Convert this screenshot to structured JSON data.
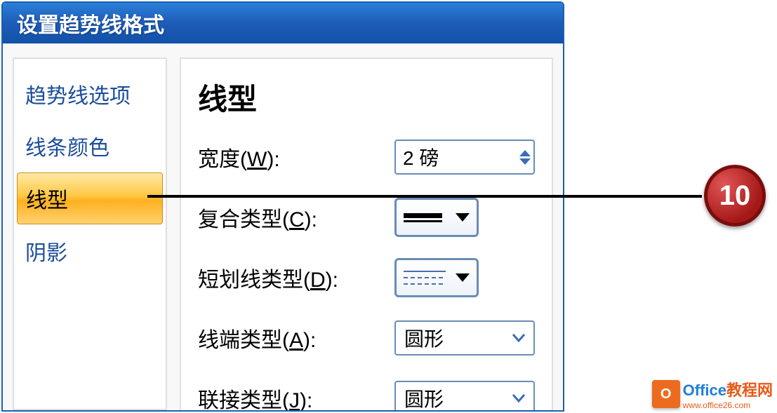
{
  "dialog": {
    "title": "设置趋势线格式"
  },
  "sidebar": {
    "items": [
      {
        "label": "趋势线选项"
      },
      {
        "label": "线条颜色"
      },
      {
        "label": "线型"
      },
      {
        "label": "阴影"
      }
    ]
  },
  "content": {
    "section_title": "线型",
    "width_label_pre": "宽度(",
    "width_mnemonic": "W",
    "width_label_post": "):",
    "width_value": "2 磅",
    "compound_label_pre": "复合类型(",
    "compound_mnemonic": "C",
    "compound_label_post": "):",
    "dash_label_pre": "短划线类型(",
    "dash_mnemonic": "D",
    "dash_label_post": "):",
    "cap_label_pre": "线端类型(",
    "cap_mnemonic": "A",
    "cap_label_post": "):",
    "cap_value": "圆形",
    "join_label_pre": "联接类型(",
    "join_mnemonic": "J",
    "join_label_post": "):",
    "join_value": "圆形"
  },
  "callout": {
    "number": "10"
  },
  "watermark": {
    "logo": "O",
    "text1": "Office",
    "text2": "教程网",
    "url": "www.office26.com"
  }
}
